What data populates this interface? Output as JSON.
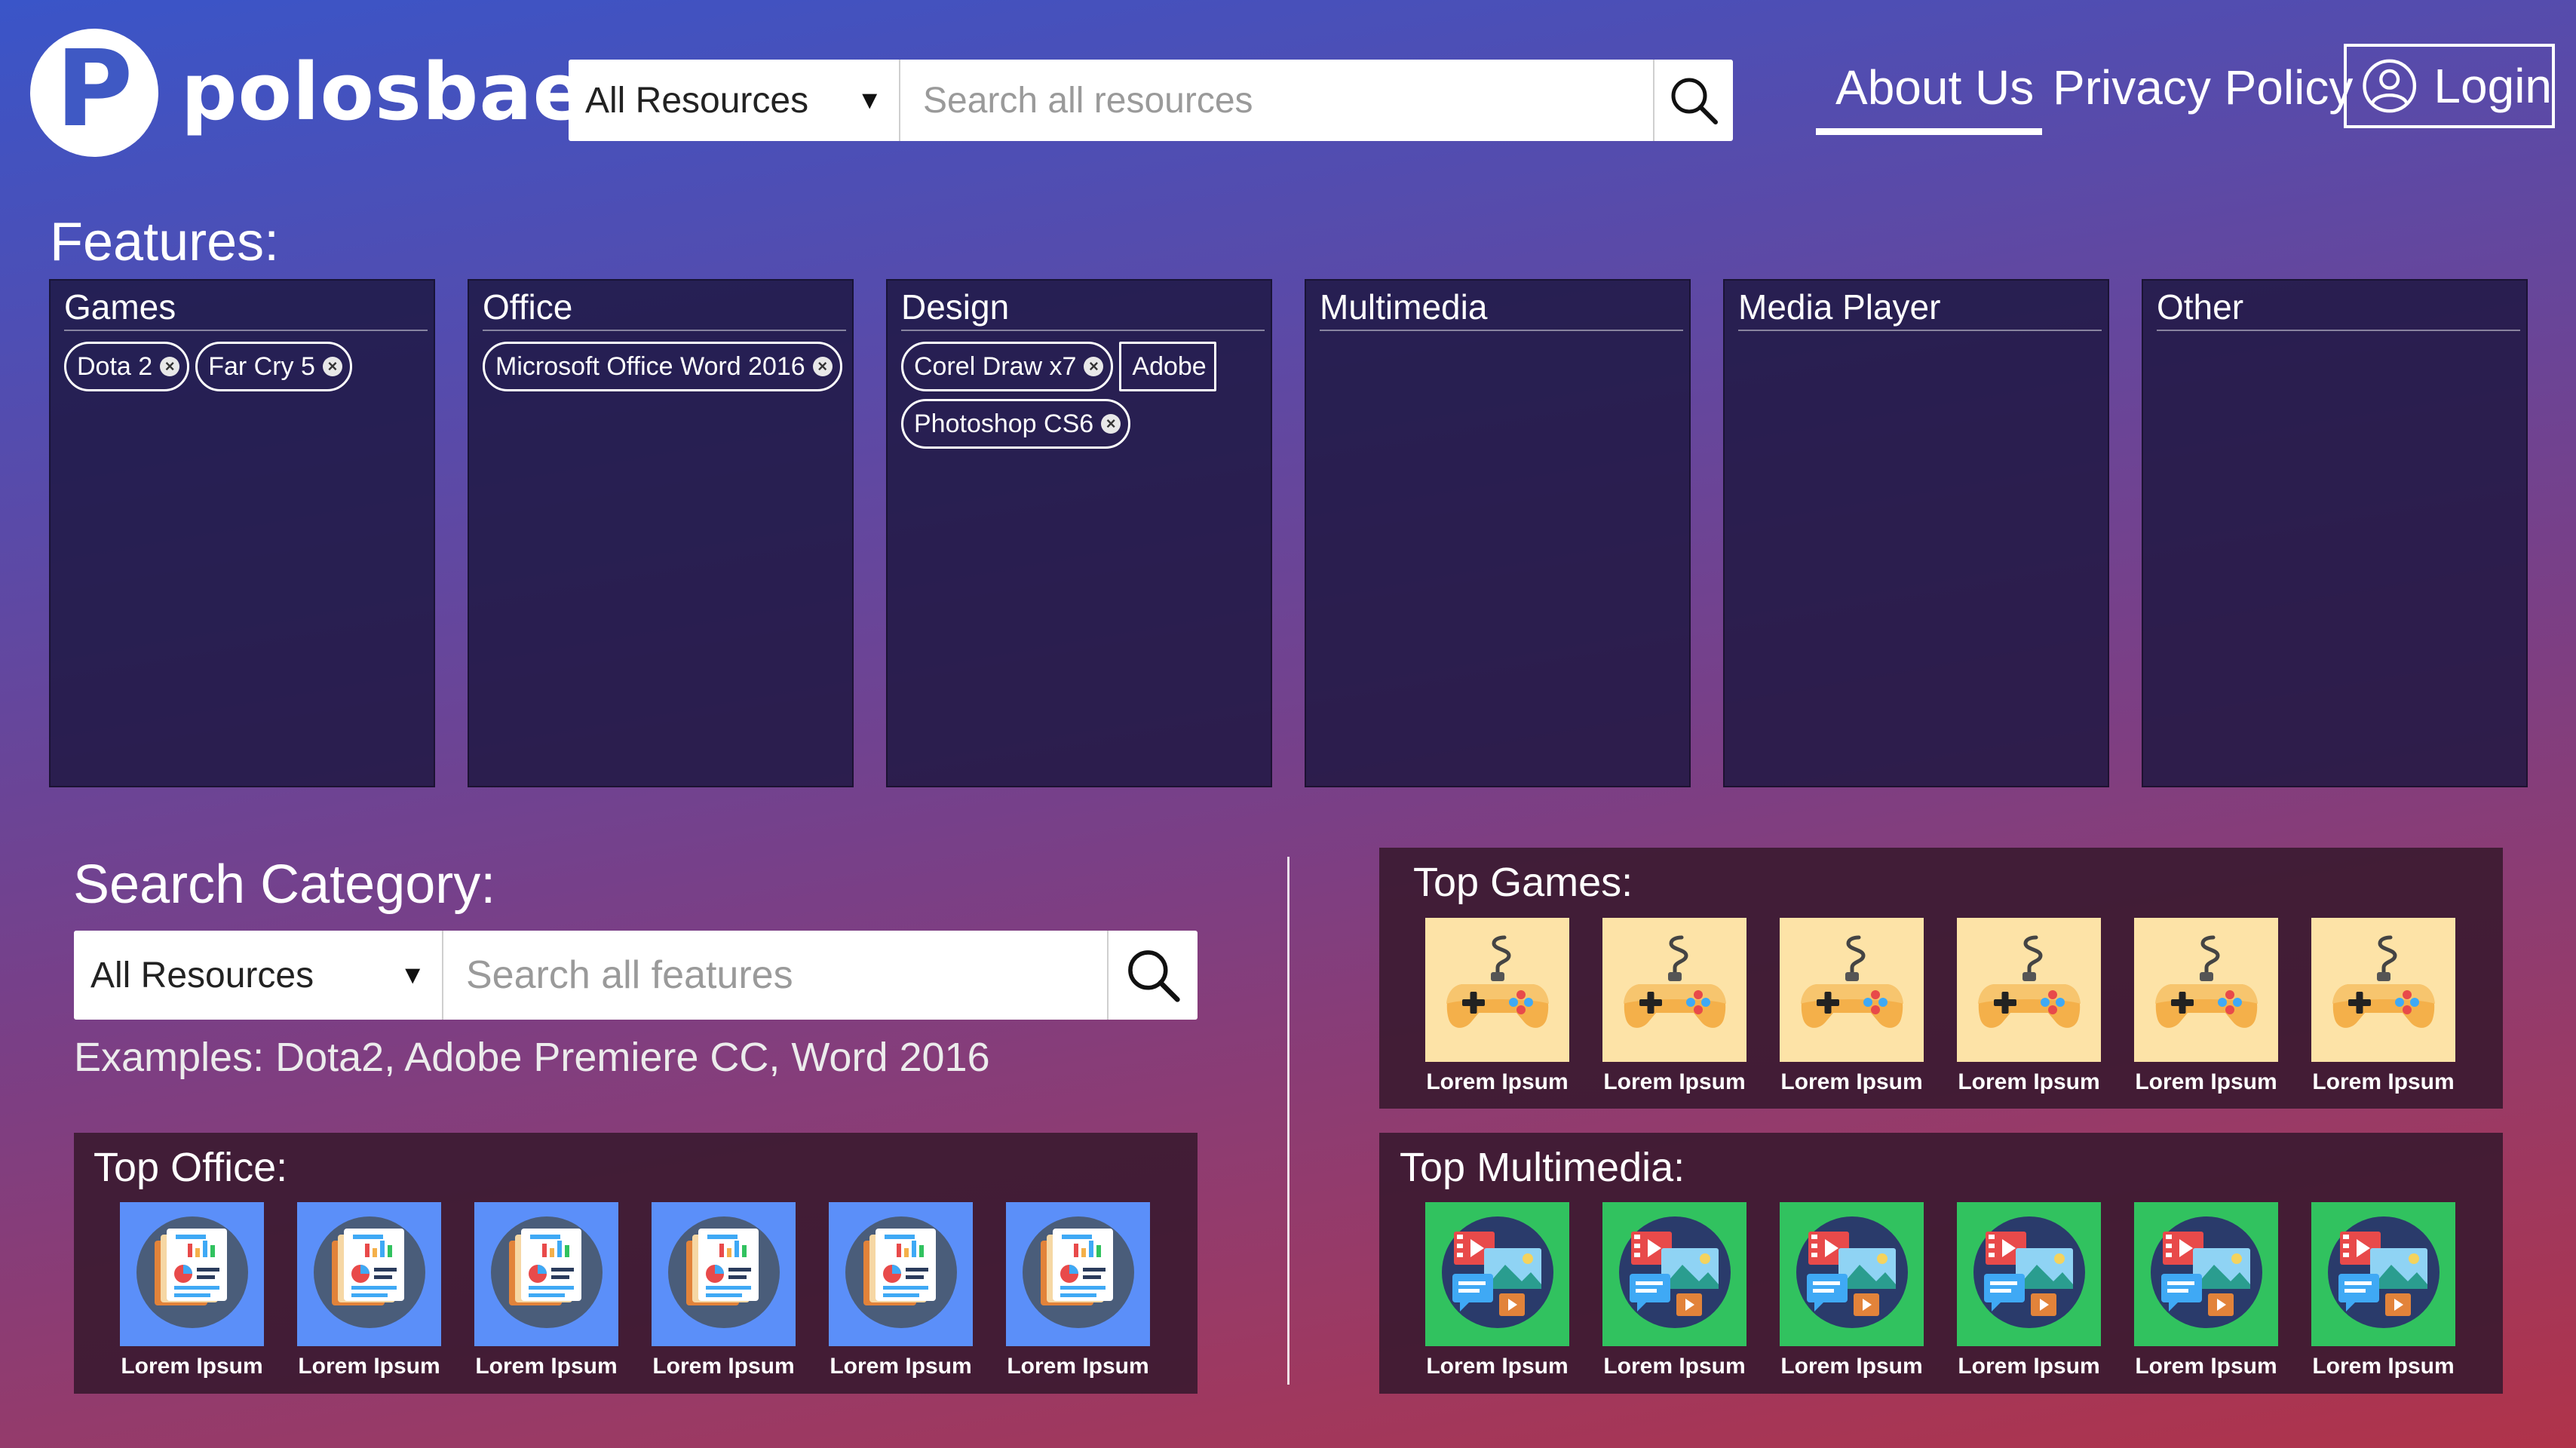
{
  "brand": {
    "name": "polosbae",
    "logo_letter": "P",
    "logo_color": "#3f59c4"
  },
  "header": {
    "resource_select": "All Resources",
    "search_placeholder": "Search all resources",
    "nav": {
      "about": "About Us",
      "privacy": "Privacy Policy",
      "login": "Login"
    },
    "active_nav": "About Us"
  },
  "features": {
    "title": "Features:",
    "cards": [
      {
        "name": "Games",
        "chips": [
          "Dota 2",
          "Far Cry 5"
        ]
      },
      {
        "name": "Office",
        "chips": [
          "Microsoft Office Word 2016"
        ]
      },
      {
        "name": "Design",
        "chips": [
          "Corel Draw x7",
          "Adobe",
          "Photoshop CS6"
        ]
      },
      {
        "name": "Multimedia",
        "chips": []
      },
      {
        "name": "Media Player",
        "chips": []
      },
      {
        "name": "Other",
        "chips": []
      }
    ]
  },
  "search_category": {
    "title": "Search Category:",
    "select": "All Resources",
    "placeholder": "Search all features",
    "examples": "Examples: Dota2, Adobe Premiere CC, Word 2016"
  },
  "top_games": {
    "title": "Top Games:",
    "icon": "gamepad-icon",
    "bg": "#fde3a7",
    "items": [
      "Lorem Ipsum",
      "Lorem Ipsum",
      "Lorem Ipsum",
      "Lorem Ipsum",
      "Lorem Ipsum",
      "Lorem Ipsum"
    ]
  },
  "top_office": {
    "title": "Top Office:",
    "icon": "office-document-icon",
    "bg": "#5b8ff9",
    "items": [
      "Lorem Ipsum",
      "Lorem Ipsum",
      "Lorem Ipsum",
      "Lorem Ipsum",
      "Lorem Ipsum",
      "Lorem Ipsum"
    ]
  },
  "top_multimedia": {
    "title": "Top Multimedia:",
    "icon": "multimedia-icon",
    "bg": "#31c25f",
    "items": [
      "Lorem Ipsum",
      "Lorem Ipsum",
      "Lorem Ipsum",
      "Lorem Ipsum",
      "Lorem Ipsum",
      "Lorem Ipsum"
    ]
  }
}
